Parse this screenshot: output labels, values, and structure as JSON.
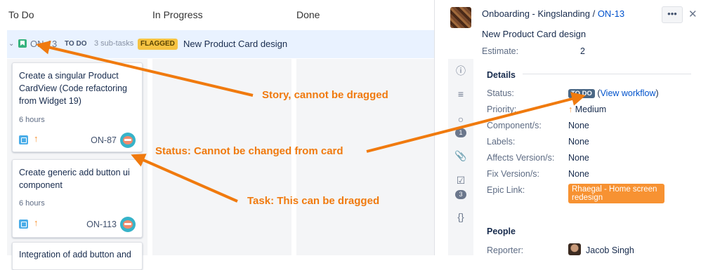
{
  "columns": [
    "To Do",
    "In Progress",
    "Done"
  ],
  "swimlane": {
    "key": "ON-13",
    "status": "TO DO",
    "subtasks": "3 sub-tasks",
    "flag": "FLAGGED",
    "title": "New Product Card design"
  },
  "cards": [
    {
      "title": "Create a singular Product CardView (Code refactoring from Widget 19)",
      "estimate": "6 hours",
      "key": "ON-87",
      "icon": "task-icon",
      "priority_icon": "arrow-up-icon"
    },
    {
      "title": "Create generic add button ui component",
      "estimate": "6 hours",
      "key": "ON-113",
      "icon": "task-icon",
      "priority_icon": "arrow-up-icon"
    },
    {
      "title": "Integration of add button and"
    }
  ],
  "detail": {
    "project": "Onboarding - Kingslanding",
    "separator": "/",
    "issue_key": "ON-13",
    "more": "•••",
    "close": "✕",
    "title": "New Product Card design",
    "estimate_label": "Estimate:",
    "estimate_value": "2",
    "rail": {
      "info": "ⓘ",
      "comments_badge": "1",
      "checklist_badge": "3",
      "code": "{}"
    },
    "details_heading": "Details",
    "fields": {
      "status_label": "Status:",
      "status_lozenge": "TO DO",
      "status_link": "View workflow",
      "priority_label": "Priority:",
      "priority_value": "Medium",
      "components_label": "Component/s:",
      "components_value": "None",
      "labels_label": "Labels:",
      "labels_value": "None",
      "affects_label": "Affects Version/s:",
      "affects_value": "None",
      "fix_label": "Fix Version/s:",
      "fix_value": "None",
      "epic_label": "Epic Link:",
      "epic_value": "Rhaegal - Home screen redesign"
    },
    "people_heading": "People",
    "reporter_label": "Reporter:",
    "reporter_value": "Jacob Singh"
  },
  "annotations": {
    "story": "Story, cannot be dragged",
    "status": "Status: Cannot be changed from card",
    "task": "Task: This can be dragged"
  },
  "colors": {
    "annotation": "#f07a0e",
    "flag": "#f6c342",
    "epic": "#f79232",
    "link": "#0052cc",
    "story": "#36b37e",
    "task": "#4bade8"
  }
}
